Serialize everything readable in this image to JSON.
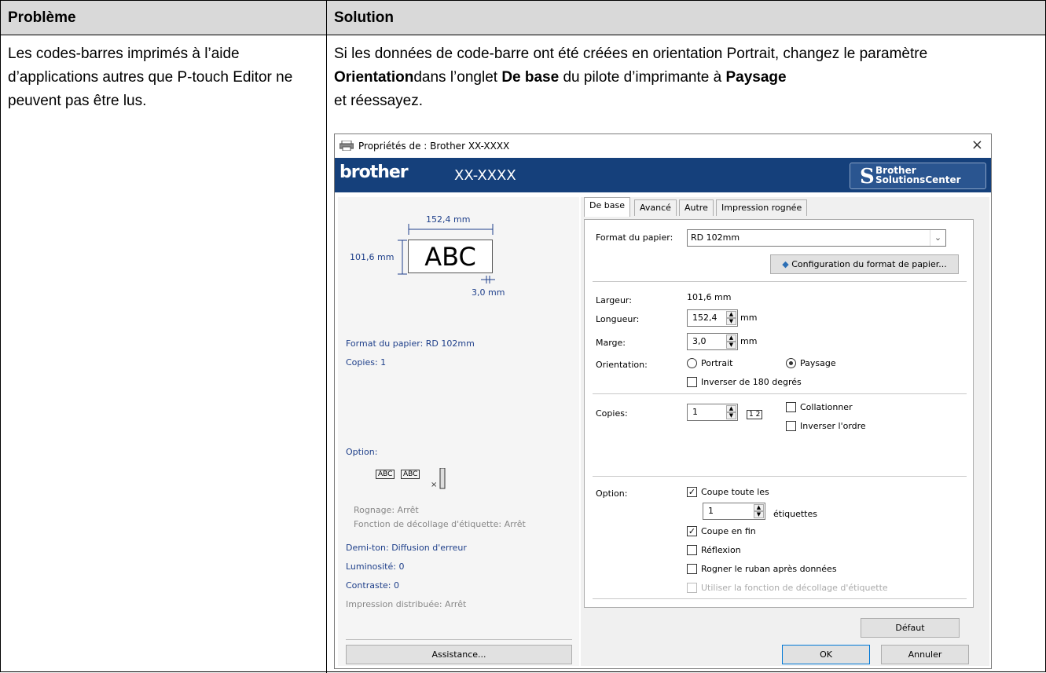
{
  "table": {
    "header_col1": "Problème",
    "header_col2": "Solution",
    "problem_text": "Les codes-barres imprimés à l’aide d’applications autres que P-touch Editor ne peuvent pas être lus.",
    "solution": {
      "part1": "Si les données de code-barre ont été créées en orientation Portrait, changez le paramètre ",
      "bold1": "Orientation",
      "part2": "dans l’onglet ",
      "bold2": "De base",
      "part3": " du pilote d’imprimante à ",
      "bold3": "Paysage",
      "part4": " et réessayez."
    }
  },
  "dialog": {
    "title": "Propriétés de : Brother  XX-XXXX",
    "close_glyph": "×",
    "banner": {
      "logo": "brother",
      "model": "XX-XXXX",
      "solutions_line1": "Brother",
      "solutions_line2": "SolutionsCenter",
      "solutions_icon": "S"
    },
    "left": {
      "preview_width": "152,4 mm",
      "preview_height": "101,6 mm",
      "preview_margin": "3,0 mm",
      "preview_text": "ABC",
      "paper_format": "Format du papier: RD 102mm",
      "copies": "Copies: 1",
      "option_label": "Option:",
      "option_icon_text1": "ABC",
      "option_icon_text2": "ABC",
      "trim": "Rognage: Arrêt",
      "peel": "Fonction de décollage d'étiquette: Arrêt",
      "halftone": "Demi-ton: Diffusion d'erreur",
      "brightness": "Luminosité:  0",
      "contrast": "Contraste:  0",
      "distributed": "Impression distribuée: Arrêt",
      "assist_button": "Assistance..."
    },
    "tabs": [
      "De base",
      "Avancé",
      "Autre",
      "Impression rognée"
    ],
    "basic": {
      "paper_label": "Format du papier:",
      "paper_value": "RD 102mm",
      "paper_config_button": "Configuration du format de papier...",
      "width_label": "Largeur:",
      "width_value": "101,6 mm",
      "length_label": "Longueur:",
      "length_value": "152,4",
      "length_unit": "mm",
      "margin_label": "Marge:",
      "margin_value": "3,0",
      "margin_unit": "mm",
      "orientation_label": "Orientation:",
      "portrait": "Portrait",
      "landscape": "Paysage",
      "rotate180": "Inverser de 180 degrés",
      "copies_label": "Copies:",
      "copies_value": "1",
      "collate": "Collationner",
      "reverse_order": "Inverser l'ordre",
      "option_label": "Option:",
      "cut_every": "Coupe toute les",
      "cut_every_value": "1",
      "labels_unit": "étiquettes",
      "cut_at_end": "Coupe en fin",
      "mirror": "Réflexion",
      "trim_tape": "Rogner le ruban après données",
      "use_peel": "Utiliser la fonction de décollage d'étiquette",
      "default_button": "Défaut"
    },
    "ok_button": "OK",
    "cancel_button": "Annuler"
  }
}
